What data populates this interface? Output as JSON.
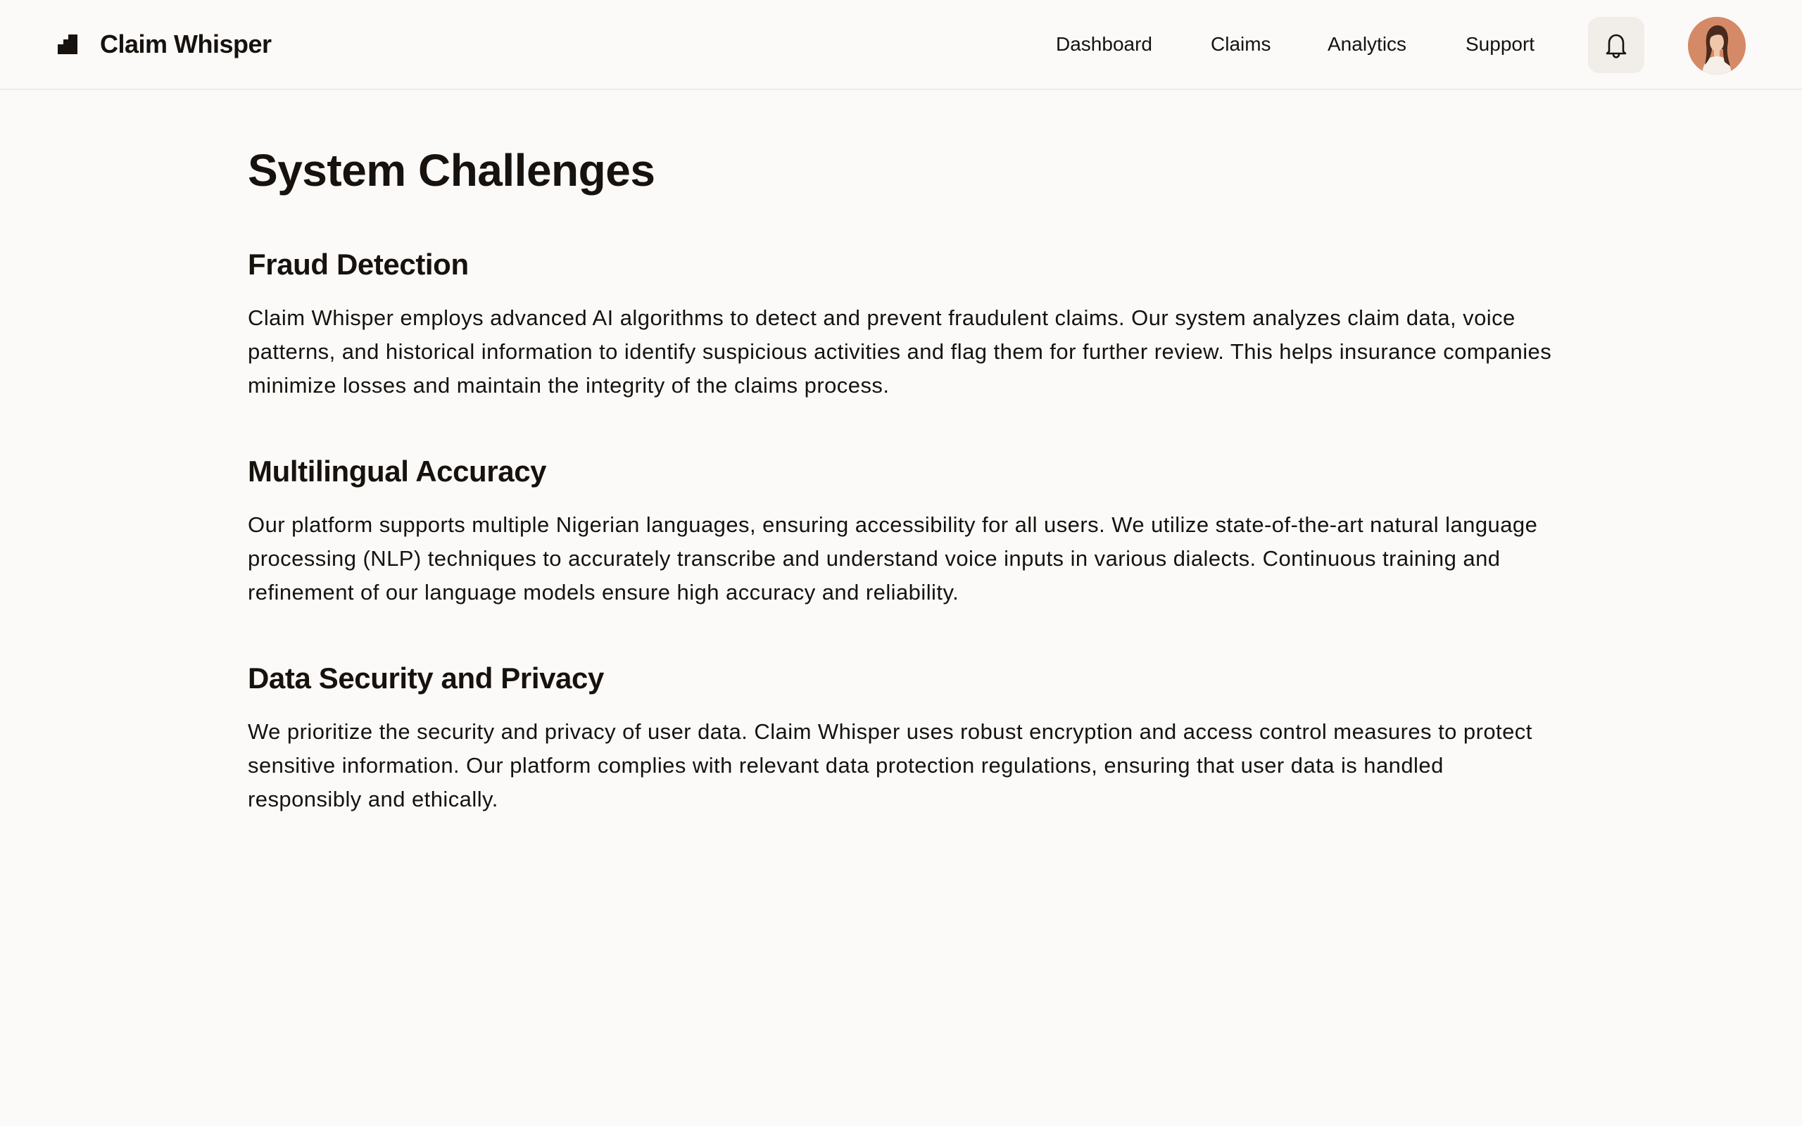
{
  "app": {
    "name": "Claim Whisper",
    "logo_icon": "staircase-logo-icon"
  },
  "nav": {
    "items": [
      {
        "label": "Dashboard"
      },
      {
        "label": "Claims"
      },
      {
        "label": "Analytics"
      },
      {
        "label": "Support"
      }
    ],
    "notification_icon": "bell-icon",
    "avatar_icon": "user-avatar"
  },
  "page": {
    "title": "System Challenges",
    "sections": [
      {
        "title": "Fraud Detection",
        "body": "Claim Whisper employs advanced AI algorithms to detect and prevent fraudulent claims. Our system analyzes claim data, voice patterns, and historical information to identify suspicious activities and flag them for further review. This helps insurance companies minimize losses and maintain the integrity of the claims process."
      },
      {
        "title": "Multilingual Accuracy",
        "body": "Our platform supports multiple Nigerian languages, ensuring accessibility for all users. We utilize state-of-the-art natural language processing (NLP) techniques to accurately transcribe and understand voice inputs in various dialects. Continuous training and refinement of our language models ensure high accuracy and reliability."
      },
      {
        "title": "Data Security and Privacy",
        "body": "We prioritize the security and privacy of user data. Claim Whisper uses robust encryption and access control measures to protect sensitive information. Our platform complies with relevant data protection regulations, ensuring that user data is handled responsibly and ethically."
      }
    ]
  },
  "colors": {
    "background": "#fbfaf8",
    "text": "#17120e",
    "border": "#efebe6",
    "button_bg": "#f1ede9",
    "avatar_bg": "#d58a67"
  }
}
